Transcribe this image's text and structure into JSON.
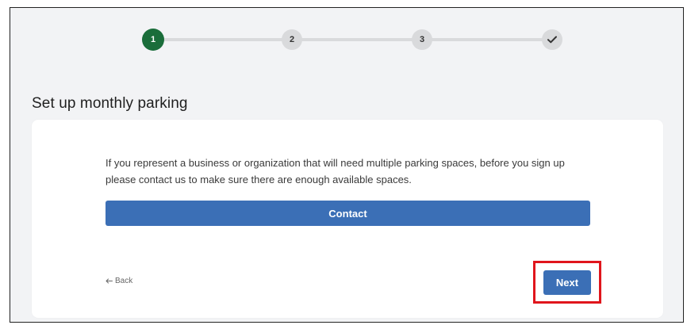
{
  "stepper": {
    "steps": [
      {
        "label": "1",
        "state": "active"
      },
      {
        "label": "2",
        "state": "pending"
      },
      {
        "label": "3",
        "state": "pending"
      },
      {
        "label": "",
        "icon": "checkmark-icon",
        "state": "pending"
      }
    ],
    "active_color": "#1a6d3a",
    "pending_color": "#d9dadc"
  },
  "page": {
    "title": "Set up monthly parking"
  },
  "card": {
    "info_text": "If you represent a business or organization that will need multiple parking spaces, before you sign up please contact us to make sure there are enough available spaces.",
    "contact_label": "Contact",
    "back_label": "Back",
    "back_icon": "arrow-left-icon",
    "next_label": "Next"
  },
  "colors": {
    "button": "#3b6fb6",
    "highlight": "#e0151c"
  }
}
